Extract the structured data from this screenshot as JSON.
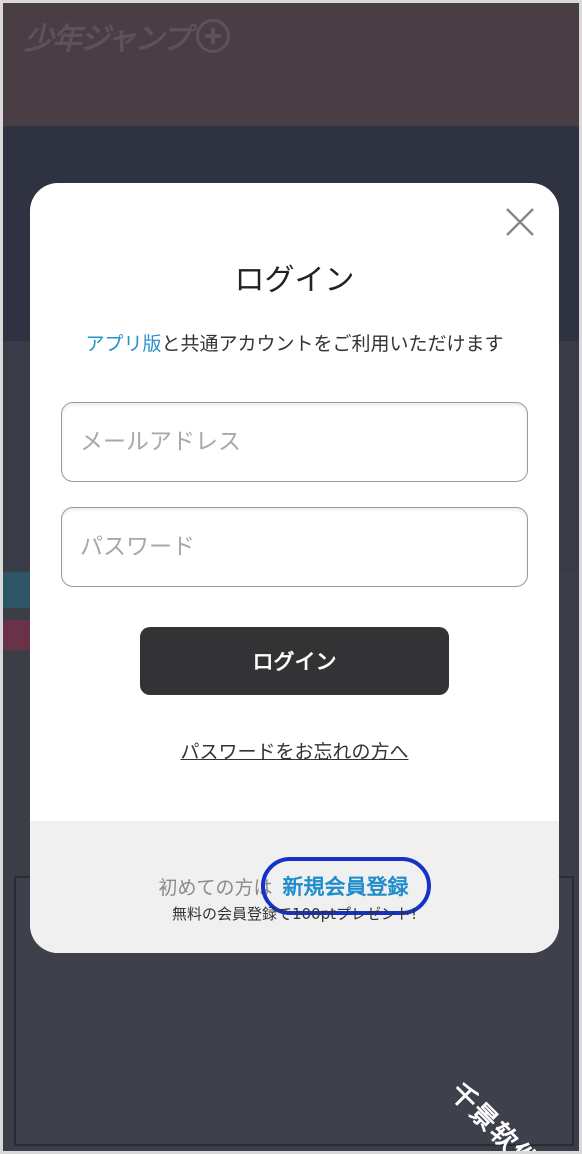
{
  "background": {
    "logo_text": "少年ジャンプ",
    "logo_plus": "+"
  },
  "modal": {
    "close_icon": "close-icon",
    "title": "ログイン",
    "subtitle_link": "アプリ版",
    "subtitle_rest": "と共通アカウントをご利用いただけます",
    "email_placeholder": "メールアドレス",
    "password_placeholder": "パスワード",
    "email_value": "",
    "password_value": "",
    "login_button": "ログイン",
    "forgot_password": "パスワードをお忘れの方へ"
  },
  "footer": {
    "first_time_prefix": "初めての方は",
    "register_link": "新規会員登録",
    "promo": "無料の会員登録で100ptプレゼント!"
  },
  "watermark": "千景软件站",
  "colors": {
    "link_blue": "#2a8fcc",
    "highlight_ring": "#1431c9",
    "button_dark": "#333335"
  }
}
